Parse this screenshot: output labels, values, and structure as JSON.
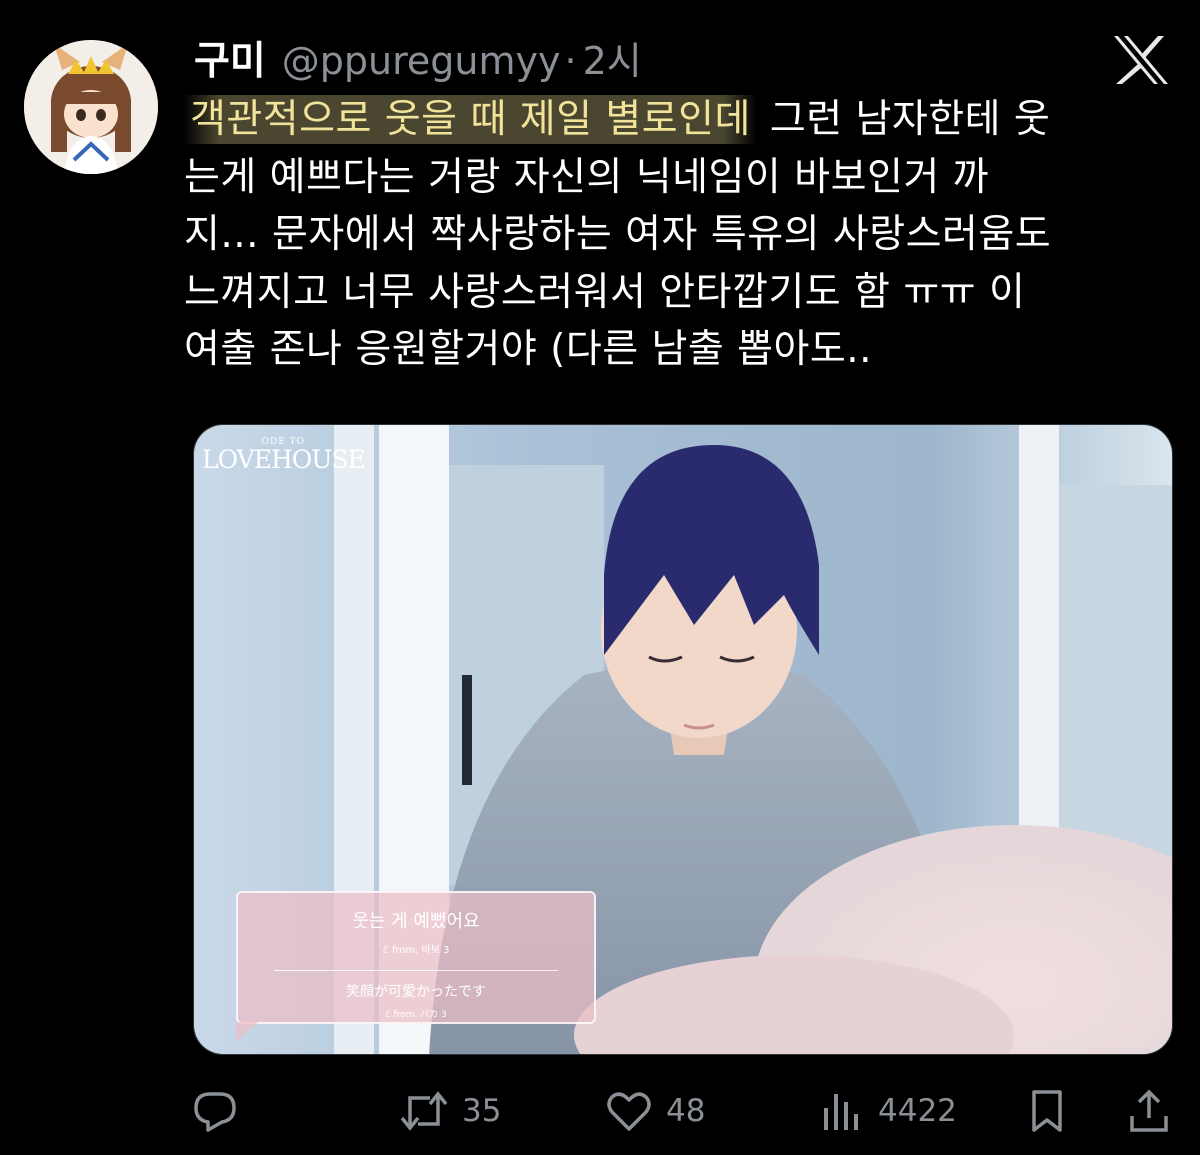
{
  "author": {
    "name": "구미",
    "handle": "@ppuregumyy",
    "separator": "·",
    "time": "2시"
  },
  "tweet": {
    "lines": [
      {
        "highlight": "객관적으로 웃을 때 제일 별로인데",
        "rest": " 그런 남자한테 웃"
      },
      {
        "text": "는게 예쁘다는 거랑 자신의 닉네임이 바보인거 까"
      },
      {
        "text": "지... 문자에서 짝사랑하는 여자 특유의 사랑스러움도"
      },
      {
        "text": "느껴지고 너무 사랑스러워서 안타깝기도 함 ㅠㅠ 이"
      },
      {
        "text": "여출 존나 응원할거야 (다른 남출 뽑아도.."
      }
    ]
  },
  "media": {
    "logo_top": "ODE TO",
    "logo_main": "LOVEHOUSE",
    "caption_ko": "웃는 게 예뻤어요",
    "caption_ko_from": "ℰ from. 바보 3",
    "caption_jp": "笑顔が可愛かったです",
    "caption_jp_from": "ℰ from. バカ 3"
  },
  "actions": {
    "reply_icon": "reply-icon",
    "retweet_icon": "retweet-icon",
    "retweets": "35",
    "like_icon": "heart-icon",
    "likes": "48",
    "views_icon": "views-icon",
    "views": "4422",
    "bookmark_icon": "bookmark-icon",
    "share_icon": "share-icon"
  },
  "colors": {
    "background": "#000000",
    "text": "#ffffff",
    "muted": "#8b9096",
    "highlight_text": "#f2e39a",
    "caption_box": "#ecbec6"
  }
}
